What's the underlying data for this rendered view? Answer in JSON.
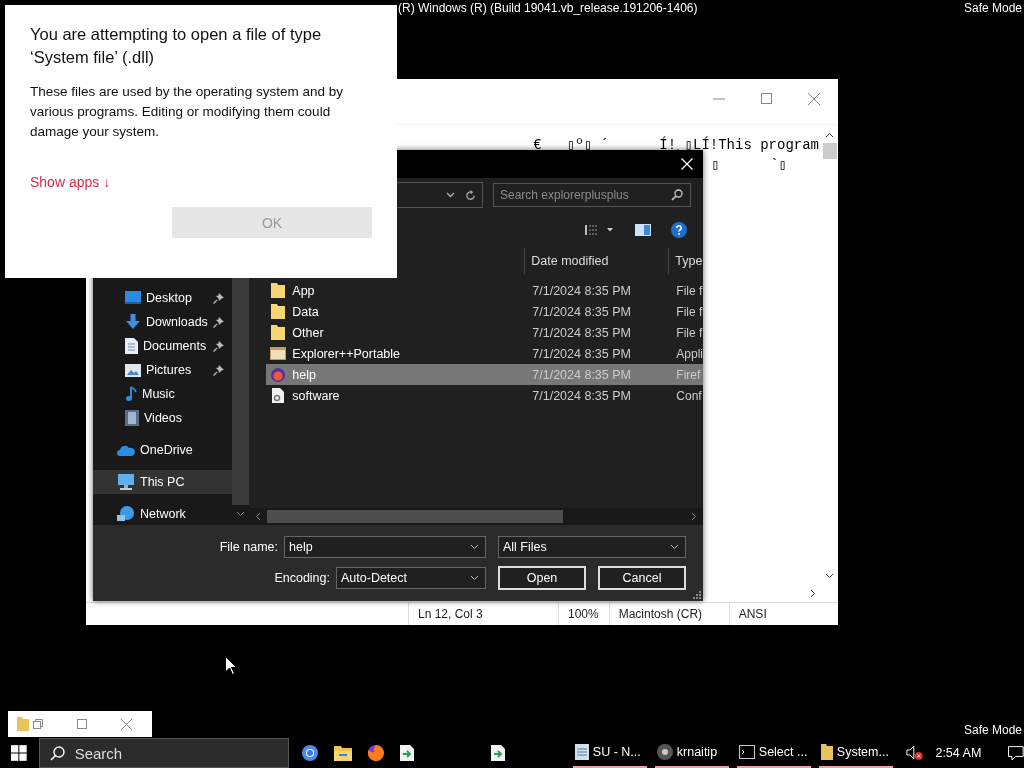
{
  "desktop": {
    "build_banner": "(R) Windows (R) (Build 19041.vb_release.191206-1406)",
    "safe_mode_top": "Safe Mode",
    "safe_mode_bottom": "Safe Mode"
  },
  "notepad": {
    "lines": [
      "€   ▯º▯ ´      Í!¸▯LÍ!This program",
      "▯      `▯"
    ],
    "status_bar": [
      "Ln 12, Col 3",
      "100%",
      "Macintosh (CR)",
      "ANSI"
    ]
  },
  "open_dialog": {
    "search": {
      "placeholder": "Search explorerplusplus"
    },
    "columns": [
      "Date modified",
      "Type"
    ],
    "nav_items": [
      {
        "label": "Desktop",
        "pinned": true,
        "selected": false
      },
      {
        "label": "Downloads",
        "pinned": true,
        "selected": false
      },
      {
        "label": "Documents",
        "pinned": true,
        "selected": false
      },
      {
        "label": "Pictures",
        "pinned": true,
        "selected": false
      },
      {
        "label": "Music",
        "pinned": false,
        "selected": false
      },
      {
        "label": "Videos",
        "pinned": false,
        "selected": false
      },
      {
        "label": "OneDrive",
        "pinned": false,
        "selected": false
      },
      {
        "label": "This PC",
        "pinned": false,
        "selected": true
      },
      {
        "label": "Network",
        "pinned": false,
        "selected": false
      }
    ],
    "files": [
      {
        "kind": "folder",
        "name": "App",
        "date": "7/1/2024 8:35 PM",
        "type": "File f",
        "selected": false
      },
      {
        "kind": "folder",
        "name": "Data",
        "date": "7/1/2024 8:35 PM",
        "type": "File f",
        "selected": false
      },
      {
        "kind": "folder",
        "name": "Other",
        "date": "7/1/2024 8:35 PM",
        "type": "File f",
        "selected": false
      },
      {
        "kind": "app",
        "name": "Explorer++Portable",
        "date": "7/1/2024 8:35 PM",
        "type": "Appli",
        "selected": false
      },
      {
        "kind": "browser",
        "name": "help",
        "date": "7/1/2024 8:35 PM",
        "type": "Firef",
        "selected": true
      },
      {
        "kind": "config",
        "name": "software",
        "date": "7/1/2024 8:35 PM",
        "type": "Conf",
        "selected": false
      }
    ],
    "file_name_label": "File name:",
    "file_name": "help",
    "file_type": "All Files",
    "encoding_label": "Encoding:",
    "encoding": "Auto-Detect",
    "buttons": [
      "Open",
      "Cancel"
    ]
  },
  "popup": {
    "title": "You are attempting to open a file of type ‘System file’ (.dll)",
    "body": "These files are used by the operating system and by various programs. Editing or modifying them could damage your system.",
    "link": "Show apps ↓",
    "ok": {
      "label": "OK",
      "disabled": true
    }
  },
  "taskbar": {
    "search": "Search",
    "running": [
      {
        "label": "SU - N..."
      },
      {
        "label": "krnaitip"
      },
      {
        "label": "Select ..."
      },
      {
        "label": "System..."
      }
    ],
    "clock": "2:54 AM"
  }
}
